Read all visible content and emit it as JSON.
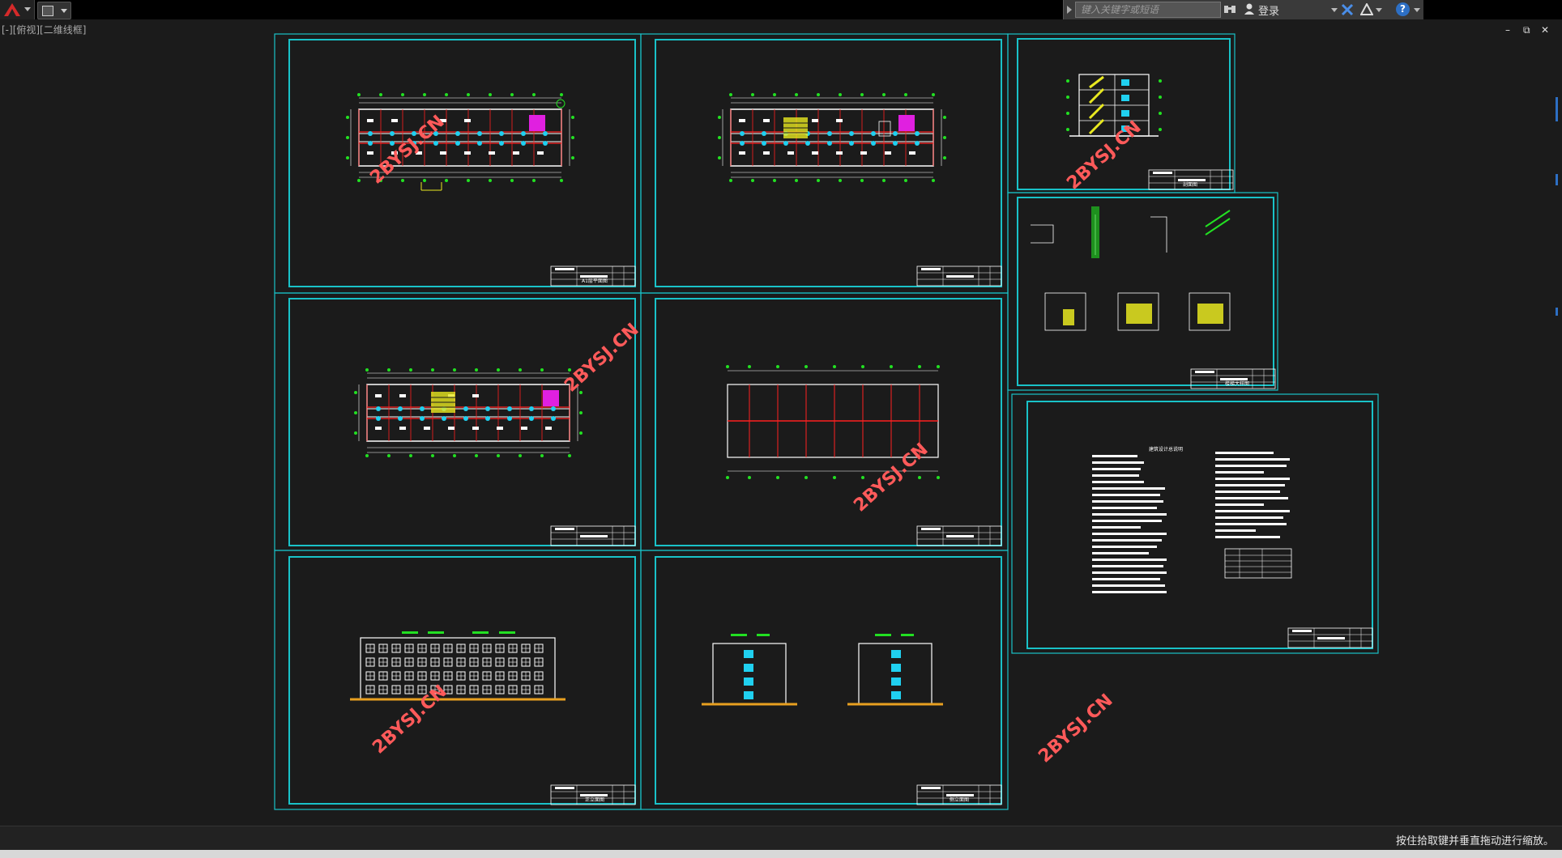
{
  "app": {
    "title": "AutoCAD"
  },
  "infocenter": {
    "search_placeholder": "键入关键字或短语",
    "login_label": "登录",
    "help_label": "?"
  },
  "viewport": {
    "label": "[-][俯视][二维线框]"
  },
  "window_controls": {
    "minimize": "–",
    "restore": "⧉",
    "close": "✕"
  },
  "status": {
    "message": "按住拾取键并垂直拖动进行缩放。"
  },
  "watermark": {
    "text": "2BYSJ.CN"
  },
  "sheets": [
    {
      "name": "sheet-floor-plan-1",
      "title": "A1层平面图"
    },
    {
      "name": "sheet-floor-plan-2",
      "title": ""
    },
    {
      "name": "sheet-section",
      "title": "剖面图"
    },
    {
      "name": "sheet-floor-plan-3",
      "title": ""
    },
    {
      "name": "sheet-roof-plan",
      "title": ""
    },
    {
      "name": "sheet-stair-detail",
      "title": "楼梯大样图"
    },
    {
      "name": "sheet-front-elevation",
      "title": "正立面图"
    },
    {
      "name": "sheet-side-elevations",
      "title": "侧立面图"
    },
    {
      "name": "sheet-design-notes",
      "title": "建筑设计总说明"
    }
  ],
  "colors": {
    "background": "#1b1b1b",
    "frame": "#19c2c8",
    "line": "#ffffff",
    "axis": "#ff2020",
    "node": "#22e022",
    "stair": "#e8e820",
    "elevator": "#e020e0",
    "window": "#20d0f0",
    "watermark": "#ff5a5a"
  }
}
